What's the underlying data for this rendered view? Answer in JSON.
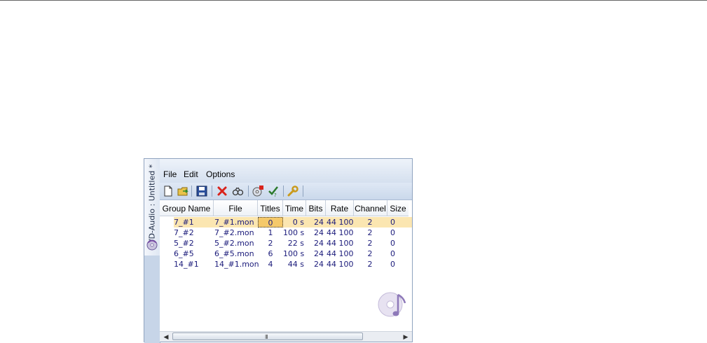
{
  "window": {
    "tab_title": "DVD-Audio : Untitled *"
  },
  "menu": {
    "file": "File",
    "edit": "Edit",
    "options": "Options"
  },
  "toolbar": {
    "buttons": [
      "new-file-icon",
      "open-folder-icon",
      "save-icon",
      "delete-icon",
      "find-icon",
      "add-disc-icon",
      "check-icon",
      "settings-wrench-icon"
    ]
  },
  "table": {
    "columns": [
      "Group Name",
      "File",
      "Titles",
      "Time",
      "Bits",
      "Rate",
      "Channel",
      "Size"
    ],
    "rows": [
      {
        "group": "7_#1",
        "file": "7_#1.mon",
        "titles": "0",
        "time": "0 s",
        "bits": "24",
        "rate": "44 100",
        "channel": "2",
        "size": "0",
        "selected": true
      },
      {
        "group": "7_#2",
        "file": "7_#2.mon",
        "titles": "1",
        "time": "100 s",
        "bits": "24",
        "rate": "44 100",
        "channel": "2",
        "size": "0"
      },
      {
        "group": "5_#2",
        "file": "5_#2.mon",
        "titles": "2",
        "time": "22 s",
        "bits": "24",
        "rate": "44 100",
        "channel": "2",
        "size": "0"
      },
      {
        "group": "6_#5",
        "file": "6_#5.mon",
        "titles": "6",
        "time": "100 s",
        "bits": "24",
        "rate": "44 100",
        "channel": "2",
        "size": "0"
      },
      {
        "group": "14_#1",
        "file": "14_#1.mon",
        "titles": "4",
        "time": "44 s",
        "bits": "24",
        "rate": "44 100",
        "channel": "2",
        "size": "0"
      }
    ]
  },
  "scrollbar": {
    "left_arrow": "◀",
    "right_arrow": "▶",
    "grip": "III"
  },
  "colors": {
    "selected_row": "#fbe6b1",
    "cell_text": "#1a1a7a",
    "frame": "#8fa3bf"
  }
}
